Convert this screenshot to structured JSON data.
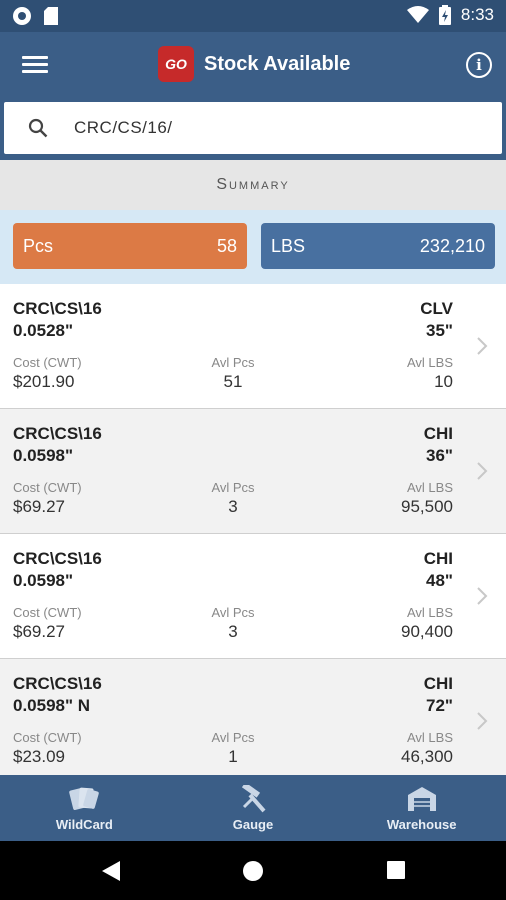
{
  "status_bar": {
    "time": "8:33",
    "icons": [
      "circle-notification-icon",
      "sd-card-icon",
      "wifi-icon",
      "battery-icon"
    ]
  },
  "app_bar": {
    "title": "Stock Available",
    "logo_text": "GO",
    "icons": [
      "menu-icon",
      "info-icon"
    ]
  },
  "search": {
    "value": "CRC/CS/16/"
  },
  "summary": {
    "label": "Summary"
  },
  "totals": {
    "pcs_label": "Pcs",
    "pcs_value": "58",
    "lbs_label": "LBS",
    "lbs_value": "232,210"
  },
  "colors": {
    "appbar": "#3b5e87",
    "pcs": "#dc7a45",
    "lbs": "#4870a0"
  },
  "items": [
    {
      "code": "CRC\\CS\\16",
      "gauge": "0.0528\"",
      "location": "CLV",
      "width": "35\"",
      "cost_label": "Cost (CWT)",
      "cost": "$201.90",
      "pcs_label": "Avl Pcs",
      "pcs": "51",
      "lbs_label": "Avl LBS",
      "lbs": "10"
    },
    {
      "code": "CRC\\CS\\16",
      "gauge": "0.0598\"",
      "location": "CHI",
      "width": "36\"",
      "cost_label": "Cost (CWT)",
      "cost": "$69.27",
      "pcs_label": "Avl Pcs",
      "pcs": "3",
      "lbs_label": "Avl LBS",
      "lbs": "95,500"
    },
    {
      "code": "CRC\\CS\\16",
      "gauge": "0.0598\"",
      "location": "CHI",
      "width": "48\"",
      "cost_label": "Cost (CWT)",
      "cost": "$69.27",
      "pcs_label": "Avl Pcs",
      "pcs": "3",
      "lbs_label": "Avl LBS",
      "lbs": "90,400"
    },
    {
      "code": "CRC\\CS\\16",
      "gauge": "0.0598\" N",
      "location": "CHI",
      "width": "72\"",
      "cost_label": "Cost (CWT)",
      "cost": "$23.09",
      "pcs_label": "Avl Pcs",
      "pcs": "1",
      "lbs_label": "Avl LBS",
      "lbs": "46,300"
    }
  ],
  "bottom_nav": [
    {
      "label": "WildCard",
      "icon": "cards-icon"
    },
    {
      "label": "Gauge",
      "icon": "gauge-tool-icon"
    },
    {
      "label": "Warehouse",
      "icon": "warehouse-icon"
    }
  ],
  "system_nav": [
    "back-icon",
    "home-icon",
    "recents-icon"
  ]
}
